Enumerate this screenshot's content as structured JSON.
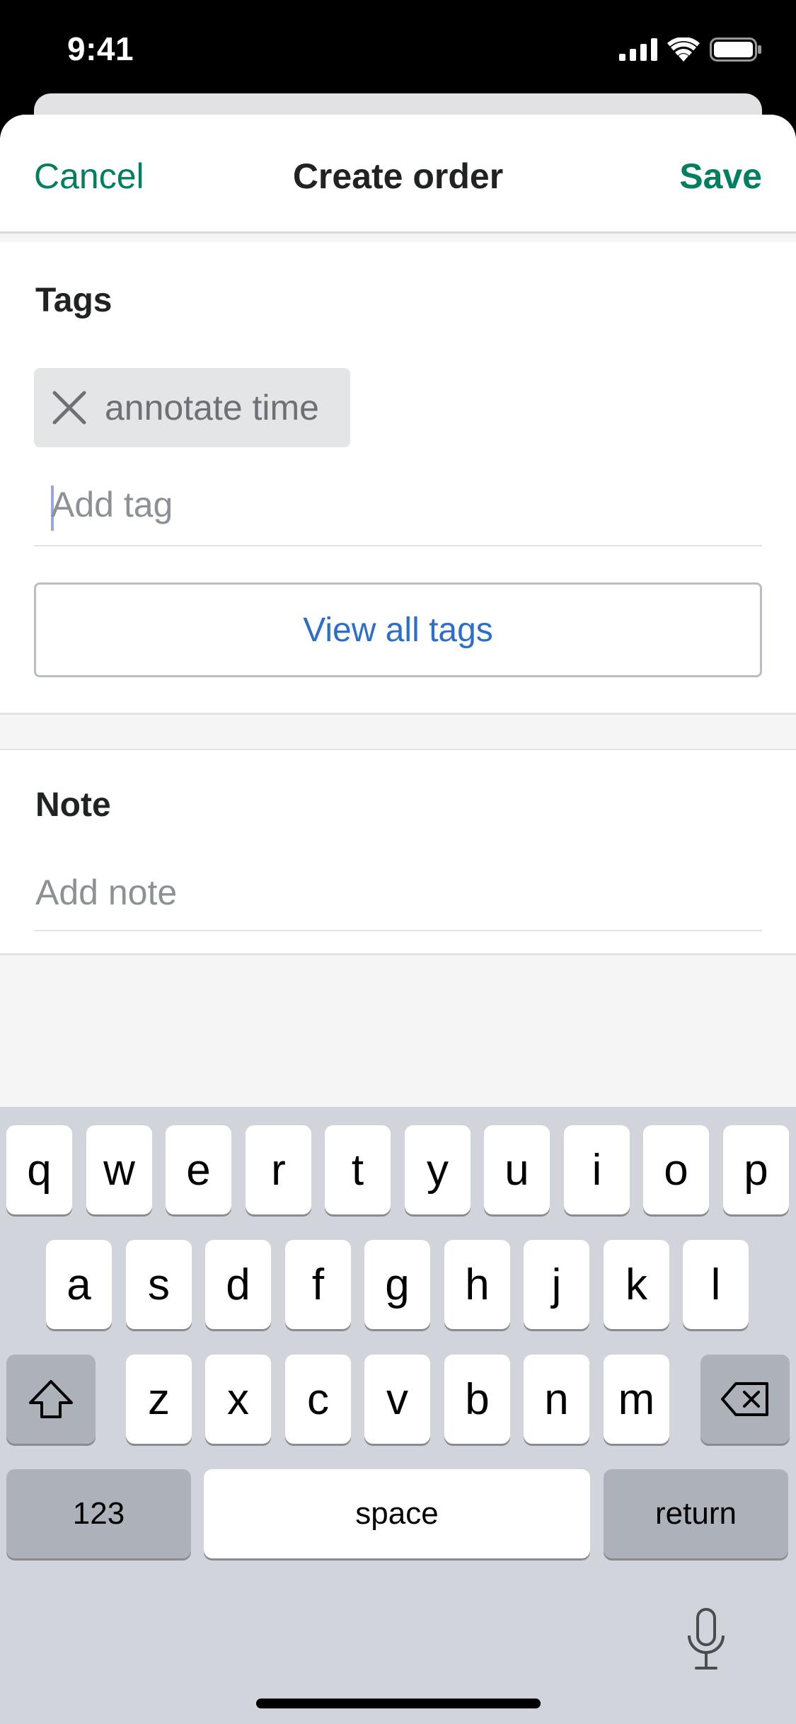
{
  "status_bar": {
    "time": "9:41"
  },
  "nav": {
    "cancel_label": "Cancel",
    "title": "Create order",
    "save_label": "Save"
  },
  "tags": {
    "heading": "Tags",
    "chips": [
      {
        "label": "annotate time"
      }
    ],
    "add_placeholder": "Add tag",
    "view_all_label": "View all tags"
  },
  "note": {
    "heading": "Note",
    "placeholder": "Add note"
  },
  "keyboard": {
    "row1": [
      "q",
      "w",
      "e",
      "r",
      "t",
      "y",
      "u",
      "i",
      "o",
      "p"
    ],
    "row2": [
      "a",
      "s",
      "d",
      "f",
      "g",
      "h",
      "j",
      "k",
      "l"
    ],
    "row3": [
      "z",
      "x",
      "c",
      "v",
      "b",
      "n",
      "m"
    ],
    "numbers_label": "123",
    "space_label": "space",
    "return_label": "return"
  },
  "colors": {
    "accent": "#008060",
    "link": "#2c6ecb"
  }
}
